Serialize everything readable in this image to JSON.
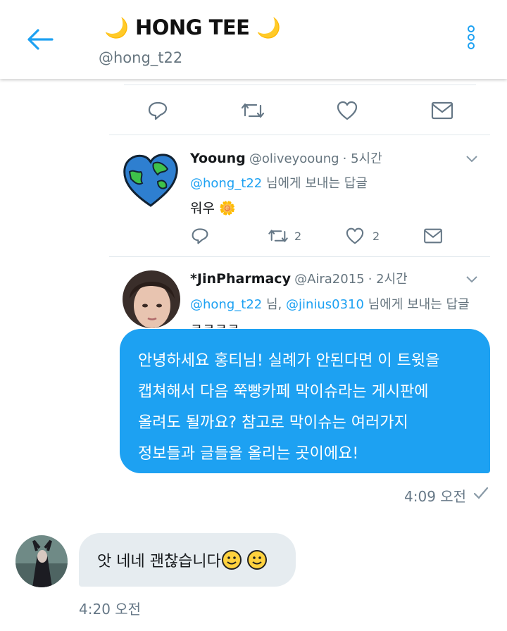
{
  "header": {
    "moon_left": "🌙",
    "title": "HONG TEE",
    "moon_right": "🌙",
    "handle": "@hong_t22"
  },
  "tweet1": {
    "name": "Yooung",
    "handle": "@oliveyooung",
    "time": "· 5시간",
    "reply_to": "@hong_t22",
    "reply_suffix": " 님에게 보내는 답글",
    "text": "워우",
    "text_emoji": "🌼",
    "retweets": "2",
    "likes": "2"
  },
  "tweet2": {
    "name": "*JinPharmacy",
    "handle": "@Aira2015",
    "time": "· 2시간",
    "reply_to1": "@hong_t22",
    "reply_mid": " 님, ",
    "reply_to2": "@jinius0310",
    "reply_suffix": " 님에게 보내는 답글",
    "text_partial": "ㅋㅋㅋㅋ"
  },
  "messages": {
    "outgoing": {
      "lines": [
        "안녕하세요 홍티님! 실례가 안된다면 이 트윗을",
        "캡쳐해서 다음 쭉빵카페 막이슈라는 게시판에",
        "올려도 될까요? 참고로 막이슈는 여러가지",
        "정보들과 글들을 올리는 곳이에요!"
      ],
      "time": "4:09 오전"
    },
    "incoming": {
      "text": "앗 네네 괜찮습니다",
      "time": "4:20 오전"
    }
  },
  "colors": {
    "accent": "#1da1f2",
    "bubble_in": "#e6ecf0",
    "meta": "#66757f"
  },
  "icons": [
    "back-arrow-icon",
    "more-options-icon",
    "reply-icon",
    "retweet-icon",
    "like-icon",
    "message-icon",
    "chevron-down-icon",
    "check-icon",
    "smiley-icon"
  ]
}
